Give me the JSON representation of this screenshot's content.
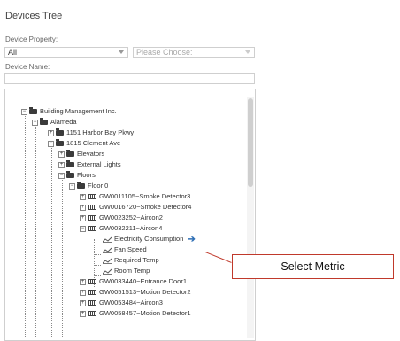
{
  "panel": {
    "title": "Devices Tree"
  },
  "filters": {
    "device_property_label": "Device Property:",
    "device_property_value": "All",
    "second_select_placeholder": "Please Choose:",
    "device_name_label": "Device Name:",
    "device_name_value": ""
  },
  "tree": {
    "nodes": [
      {
        "label": "Building Management Inc.",
        "icon": "folder-icon",
        "expander": "minus"
      },
      {
        "label": "Alameda",
        "icon": "folder-icon",
        "expander": "minus"
      },
      {
        "label": "1151 Harbor Bay Pkwy",
        "icon": "folder-icon",
        "expander": "plus"
      },
      {
        "label": "1815 Clement Ave",
        "icon": "folder-icon",
        "expander": "minus"
      },
      {
        "label": "Elevators",
        "icon": "folder-icon",
        "expander": "plus"
      },
      {
        "label": "External Lights",
        "icon": "folder-icon",
        "expander": "plus"
      },
      {
        "label": "Floors",
        "icon": "folder-icon",
        "expander": "minus"
      },
      {
        "label": "Floor 0",
        "icon": "folder-icon",
        "expander": "minus"
      },
      {
        "label": "GW0011105~Smoke Detector3",
        "icon": "device-icon",
        "expander": "plus"
      },
      {
        "label": "GW0016720~Smoke Detector4",
        "icon": "device-icon",
        "expander": "plus"
      },
      {
        "label": "GW0023252~Aircon2",
        "icon": "device-icon",
        "expander": "plus"
      },
      {
        "label": "GW0032211~Aircon4",
        "icon": "device-icon",
        "expander": "minus"
      },
      {
        "label": "Electricity Consumption",
        "icon": "metric-icon",
        "expander": ""
      },
      {
        "label": "Fan Speed",
        "icon": "metric-icon",
        "expander": ""
      },
      {
        "label": "Required Temp",
        "icon": "metric-icon",
        "expander": ""
      },
      {
        "label": "Room Temp",
        "icon": "metric-icon",
        "expander": ""
      },
      {
        "label": "GW0033440~Entrance Door1",
        "icon": "device-icon",
        "expander": "plus"
      },
      {
        "label": "GW0051513~Motion Detector2",
        "icon": "device-icon",
        "expander": "plus"
      },
      {
        "label": "GW0053484~Aircon3",
        "icon": "device-icon",
        "expander": "plus"
      },
      {
        "label": "GW0058457~Motion Detector1",
        "icon": "device-icon",
        "expander": "plus"
      }
    ]
  },
  "callout": {
    "text": "Select Metric",
    "color": "#c0392b"
  },
  "colors": {
    "select_arrow": "#2f6fb5",
    "border": "#cfcfcf"
  }
}
